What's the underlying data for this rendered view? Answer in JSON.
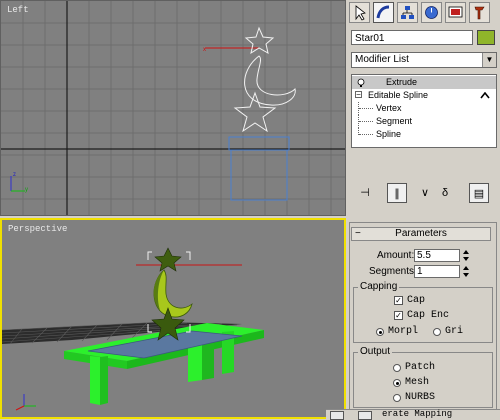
{
  "viewports": {
    "left": {
      "label": "Left"
    },
    "perspective": {
      "label": "Perspective"
    }
  },
  "command_panel": {
    "tabs": [
      "create-icon",
      "modify-icon",
      "hierarchy-icon",
      "motion-icon",
      "display-icon",
      "utilities-icon"
    ],
    "object_name": "Star01",
    "object_color": "#8fb52a",
    "modifier_list": "Modifier List",
    "stack": [
      {
        "label": "Extrude"
      },
      {
        "label": "Editable Spline"
      },
      {
        "label": "Vertex"
      },
      {
        "label": "Segment"
      },
      {
        "label": "Spline"
      }
    ]
  },
  "parameters": {
    "title": "Parameters",
    "amount_label": "Amount:",
    "amount_value": "5.5",
    "segments_label": "Segments:",
    "segments_value": "1",
    "capping": {
      "title": "Capping",
      "cap_start": "Cap",
      "cap_end": "Cap Enc",
      "morph": "Morpl",
      "grid": "Gri"
    },
    "output": {
      "title": "Output",
      "patch": "Patch",
      "mesh": "Mesh",
      "nurbs": "NURBS"
    },
    "mapping": "erate Mapping"
  }
}
